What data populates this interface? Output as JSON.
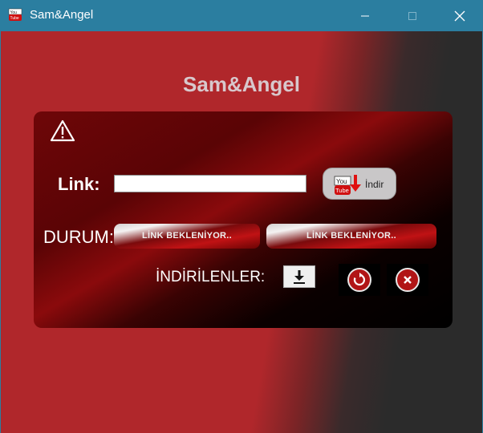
{
  "window": {
    "title": "Sam&Angel",
    "icon": "youtube-app-icon",
    "controls": [
      "minimize-icon",
      "maximize-icon",
      "close-icon"
    ]
  },
  "app": {
    "heading": "Sam&Angel"
  },
  "form": {
    "link_label": "Link:",
    "link_value": "",
    "download_button_label": "İndir",
    "status_label": "DURUM:",
    "status_1": "LİNK BEKLENİYOR..",
    "status_2": "LİNK BEKLENİYOR..",
    "downloads_label": "İNDİRİLENLER:"
  },
  "colors": {
    "titlebar": "#2b7ea0",
    "accent_red": "#b0272b",
    "panel_dark": "#5a0405"
  }
}
